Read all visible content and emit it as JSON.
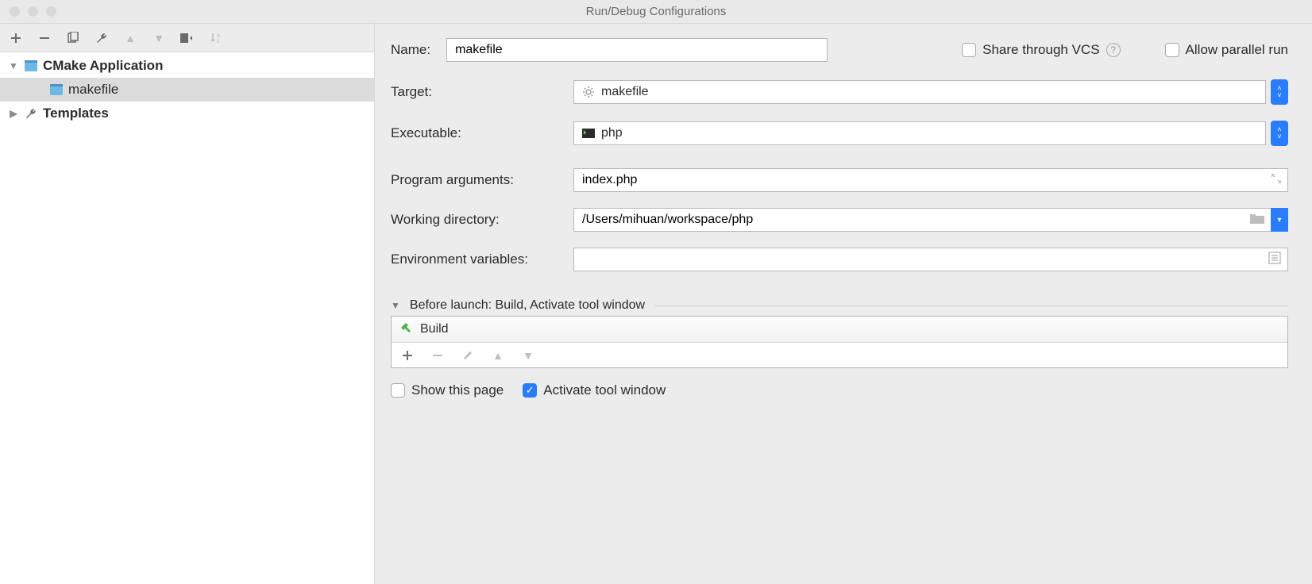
{
  "window": {
    "title": "Run/Debug Configurations"
  },
  "tree": {
    "cmake_label": "CMake Application",
    "cmake_item": "makefile",
    "templates_label": "Templates"
  },
  "form": {
    "name_label": "Name:",
    "name_value": "makefile",
    "share_label": "Share through VCS",
    "allow_parallel_label": "Allow parallel run",
    "target_label": "Target:",
    "target_value": "makefile",
    "executable_label": "Executable:",
    "executable_value": "php",
    "program_args_label": "Program arguments:",
    "program_args_value": "index.php",
    "working_dir_label": "Working directory:",
    "working_dir_value": "/Users/mihuan/workspace/php",
    "env_label": "Environment variables:",
    "env_value": ""
  },
  "before_launch": {
    "header": "Before launch: Build, Activate tool window",
    "item": "Build"
  },
  "bottom": {
    "show_this_page": "Show this page",
    "activate_tool_window": "Activate tool window"
  }
}
